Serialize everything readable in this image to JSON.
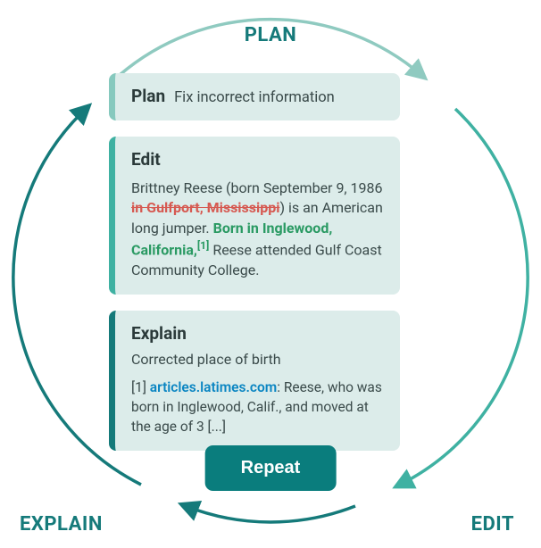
{
  "labels": {
    "plan": "PLAN",
    "edit": "EDIT",
    "explain": "EXPLAIN"
  },
  "cards": {
    "plan": {
      "title": "Plan",
      "text": "Fix incorrect information"
    },
    "edit": {
      "title": "Edit",
      "pre": "Brittney Reese (born September 9, 1986 ",
      "strike": "in Gulfport, Mississippi",
      "mid1": ") is an American long jumper. ",
      "insert": "Born in Inglewood, California,",
      "ref": "[1]",
      "mid2": " Reese attended Gulf Coast Community College."
    },
    "explain": {
      "title": "Explain",
      "summary": "Corrected place of birth",
      "cite_prefix": "[1] ",
      "cite_link": "articles.latimes.com",
      "cite_sep": ": ",
      "cite_body": "Reese, who was born in Inglewood, Calif., and moved at the age of 3 [...]"
    }
  },
  "repeat": "Repeat",
  "colors": {
    "teal_dark": "#157a7a",
    "teal_mid": "#3fb1a2",
    "teal_light": "#86c9be",
    "card_bg": "#dcecea",
    "strike": "#d65a52",
    "insert": "#2a9a63",
    "link": "#0a85c2"
  }
}
